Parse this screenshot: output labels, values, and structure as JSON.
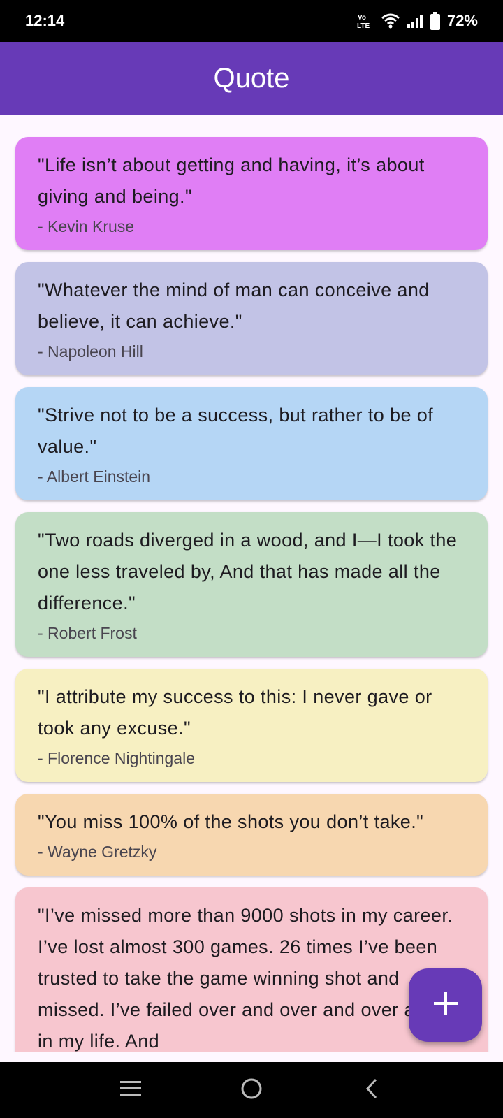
{
  "status": {
    "time": "12:14",
    "battery": "72%",
    "volte_label": "LTE"
  },
  "app_bar": {
    "title": "Quote"
  },
  "quotes": [
    {
      "text": "\"Life isn’t about getting and having, it’s about giving and being.\"",
      "author": "- Kevin Kruse",
      "color": "#E07EF5"
    },
    {
      "text": "\"Whatever the mind of man can conceive and believe, it can achieve.\"",
      "author": "- Napoleon Hill",
      "color": "#C2C3E6"
    },
    {
      "text": "\"Strive not to be a success, but rather to be of value.\"",
      "author": "- Albert Einstein",
      "color": "#B5D6F5"
    },
    {
      "text": "\"Two roads diverged in a wood, and I—I took the one less traveled by, And that has made all the difference.\"",
      "author": "- Robert Frost",
      "color": "#C3DEC6"
    },
    {
      "text": "\"I attribute my success to this: I never gave or took any excuse.\"",
      "author": "- Florence Nightingale",
      "color": "#F7F0C2"
    },
    {
      "text": "\"You miss 100% of the shots you don’t take.\"",
      "author": "- Wayne Gretzky",
      "color": "#F7D7B0"
    },
    {
      "text": "\"I’ve missed more than 9000 shots in my career. I’ve lost almost 300 games. 26 times I’ve been trusted to take the game winning shot and missed. I’ve failed over and over and over again in my life. And",
      "author": "",
      "color": "#F7C6CF"
    }
  ],
  "fab": {
    "icon": "plus-icon"
  },
  "nav": {
    "icons": [
      "menu-icon",
      "home-icon",
      "back-icon"
    ]
  }
}
